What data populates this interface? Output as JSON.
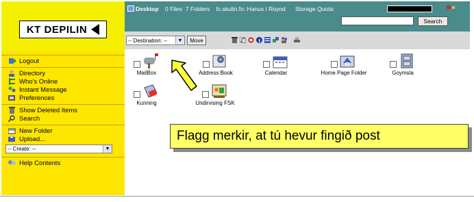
{
  "logo": {
    "text": "KT DEPILIN"
  },
  "sidebar": {
    "groups": [
      [
        {
          "label": "Logout",
          "icon": "logout-icon"
        }
      ],
      [
        {
          "label": "Directory",
          "icon": "directory-icon"
        },
        {
          "label": "Who's Online",
          "icon": "whos-online-icon"
        },
        {
          "label": "Instant Message",
          "icon": "instant-message-icon"
        },
        {
          "label": "Preferences",
          "icon": "preferences-icon"
        }
      ],
      [
        {
          "label": "Show Deleted Items",
          "icon": "deleted-items-icon"
        },
        {
          "label": "Search",
          "icon": "search-icon"
        }
      ],
      [
        {
          "label": "New Folder",
          "icon": "new-folder-icon"
        },
        {
          "label": "Upload...",
          "icon": "upload-icon"
        }
      ]
    ],
    "create_select": "-- Create: --",
    "help": {
      "label": "Help Contents",
      "icon": "help-icon"
    }
  },
  "header": {
    "location": "Desktop",
    "files": "0 Files",
    "folders": "7 Folders",
    "path": "fc.skulin.fo: Hanus í Roynd",
    "storage_label": "Storage Quota:",
    "search_button": "Search",
    "search_value": ""
  },
  "toolbar": {
    "destination": "-- Destination: --",
    "move_button": "Move"
  },
  "folders": [
    {
      "label": "MailBox",
      "icon": "mailbox-icon"
    },
    {
      "label": "Address Book",
      "icon": "address-book-icon"
    },
    {
      "label": "Calendar",
      "icon": "calendar-icon"
    },
    {
      "label": "Home Page Folder",
      "icon": "home-page-folder-icon"
    },
    {
      "label": "Goymsla",
      "icon": "storage-cabinet-icon"
    },
    {
      "label": "Kunning",
      "icon": "kunning-icon"
    },
    {
      "label": "Undirvising FSK",
      "icon": "undirvising-icon"
    }
  ],
  "callout": {
    "text": "Flagg merkir, at tú hevur fingið post"
  },
  "colors": {
    "sidebar": "#ffe600",
    "header": "#4a8b8c",
    "toolbar": "#d9d9d9",
    "callout": "#ffff66"
  }
}
